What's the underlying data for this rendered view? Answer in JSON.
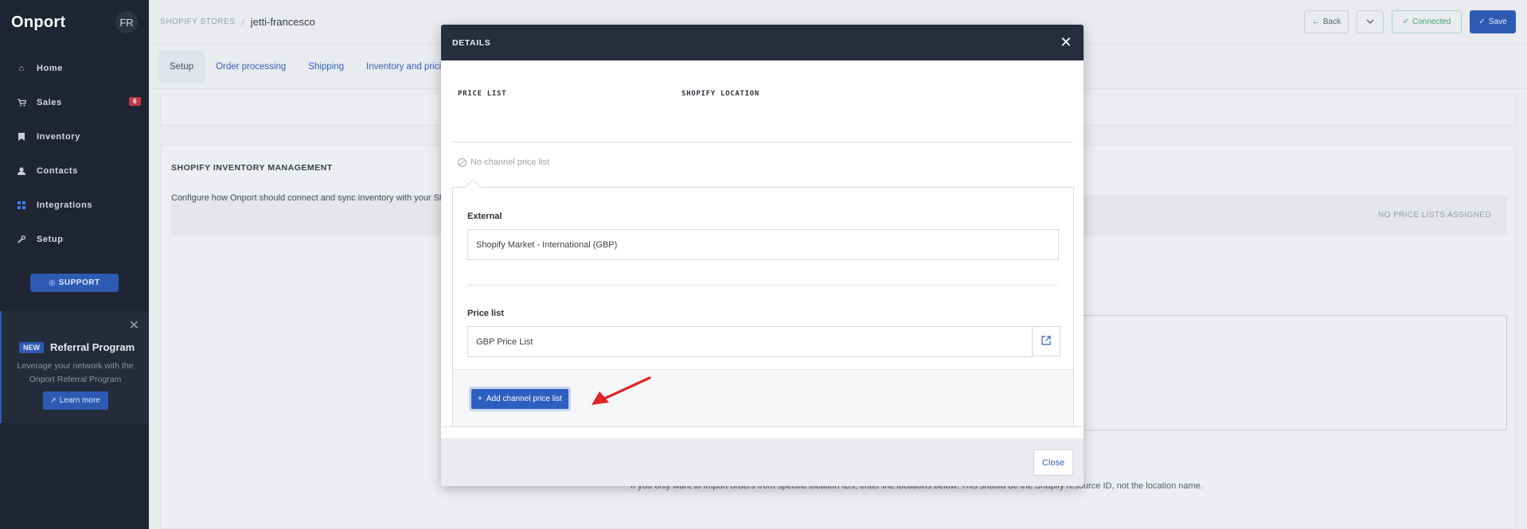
{
  "sidebar": {
    "brand": "Onport",
    "avatar": "FR",
    "items": [
      {
        "label": "Home",
        "icon": "home-icon"
      },
      {
        "label": "Sales",
        "icon": "cart-icon",
        "badge": "6"
      },
      {
        "label": "Inventory",
        "icon": "bookmark-icon"
      },
      {
        "label": "Contacts",
        "icon": "user-icon"
      },
      {
        "label": "Integrations",
        "icon": "grid-icon"
      },
      {
        "label": "Setup",
        "icon": "wrench-icon"
      }
    ],
    "support_label": "SUPPORT",
    "referral": {
      "new_label": "NEW",
      "title": "Referral Program",
      "desc_line1": "Leverage your network with the",
      "desc_line2": "Onport Referral Program",
      "learn_more": "Learn more"
    }
  },
  "topbar": {
    "crumb_parent": "SHOPIFY STORES",
    "crumb_sep": "/",
    "crumb_current": "jetti-francesco",
    "back_label": "Back",
    "connected_label": "Connected",
    "save_label": "Save"
  },
  "tabs": [
    {
      "label": "Setup"
    },
    {
      "label": "Order processing"
    },
    {
      "label": "Shipping"
    },
    {
      "label": "Inventory and pricing"
    }
  ],
  "inventory_card": {
    "title": "SHOPIFY INVENTORY MANAGEMENT",
    "desc": "Configure how Onport should connect and sync inventory with your Shop",
    "no_price_lists": "NO PRICE LISTS ASSIGNED",
    "import_desc": "If you only want to import orders from specific location IDs, enter the locations below. This should be the Shopify resource ID, not the location name."
  },
  "modal": {
    "title": "DETAILS",
    "col_price_list": "PRICE LIST",
    "col_shopify_location": "SHOPIFY LOCATION",
    "no_channel": "No channel price list",
    "external_label": "External",
    "external_value": "Shopify Market - International (GBP)",
    "price_list_label": "Price list",
    "price_list_value": "GBP Price List",
    "add_button": "Add channel price list",
    "close_button": "Close"
  },
  "colors": {
    "sidebar_bg": "#1f2532",
    "primary": "#2e5fc0",
    "modal_header": "#262d3d",
    "arrow": "#e02424"
  }
}
